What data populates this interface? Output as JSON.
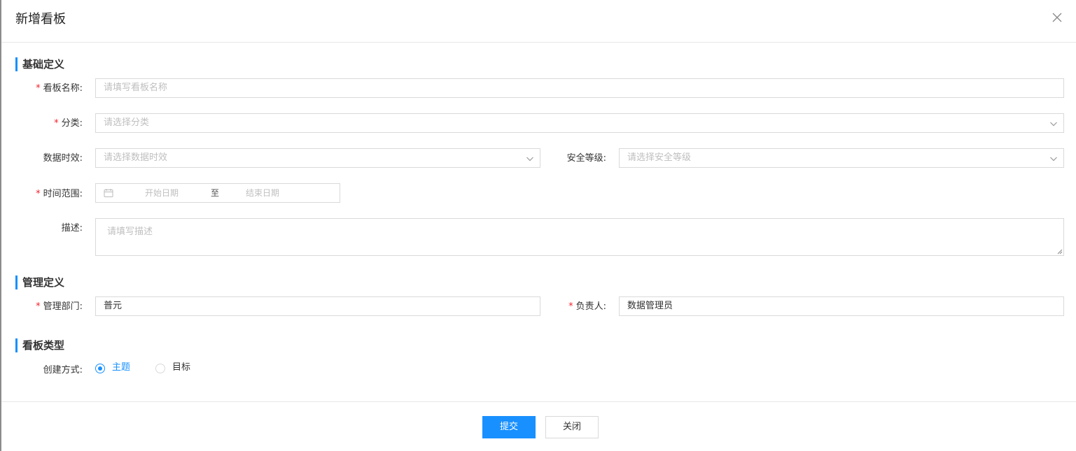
{
  "dialog": {
    "title": "新增看板"
  },
  "sections": {
    "basic": "基础定义",
    "management": "管理定义",
    "board_type": "看板类型"
  },
  "required_mark": "*",
  "fields": {
    "name": {
      "label": "看板名称:",
      "placeholder": "请填写看板名称"
    },
    "category": {
      "label": "分类:",
      "placeholder": "请选择分类"
    },
    "timeliness": {
      "label": "数据时效:",
      "placeholder": "请选择数据时效"
    },
    "security": {
      "label": "安全等级:",
      "placeholder": "请选择安全等级"
    },
    "time_range": {
      "label": "时间范围:",
      "start_placeholder": "开始日期",
      "separator": "至",
      "end_placeholder": "结束日期"
    },
    "description": {
      "label": "描述:",
      "placeholder": "请填写描述"
    },
    "department": {
      "label": "管理部门:",
      "value": "普元"
    },
    "owner": {
      "label": "负责人:",
      "value": "数据管理员"
    },
    "creation_method": {
      "label": "创建方式:",
      "options": [
        {
          "label": "主题",
          "selected": true
        },
        {
          "label": "目标",
          "selected": false
        }
      ]
    }
  },
  "footer": {
    "submit_label": "提交",
    "close_label": "关闭"
  },
  "colors": {
    "accent": "#1890ff",
    "required": "#f5222d",
    "border": "#d9d9d9",
    "placeholder": "#bfbfbf"
  },
  "icons": {
    "close": "close-icon",
    "dropdown": "chevron-down-icon",
    "calendar": "calendar-icon"
  }
}
